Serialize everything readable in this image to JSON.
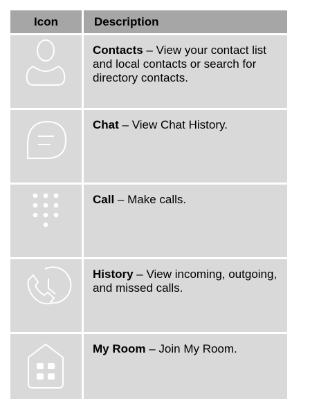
{
  "table": {
    "headers": {
      "icon": "Icon",
      "description": "Description"
    },
    "separator": " – ",
    "rows": [
      {
        "icon": "person-icon",
        "term": "Contacts",
        "text": "View your contact list and local contacts or search for directory contacts."
      },
      {
        "icon": "chat-bubble-icon",
        "term": "Chat",
        "text": "View Chat History."
      },
      {
        "icon": "dialpad-icon",
        "term": "Call",
        "text": "Make calls."
      },
      {
        "icon": "phone-clock-icon",
        "term": "History",
        "text": "View incoming, outgoing, and missed calls."
      },
      {
        "icon": "room-house-icon",
        "term": "My Room",
        "text": "Join My Room."
      }
    ]
  },
  "colors": {
    "header_bg": "#a6a6a6",
    "cell_bg": "#d9d9d9",
    "icon_stroke": "#ffffff"
  }
}
